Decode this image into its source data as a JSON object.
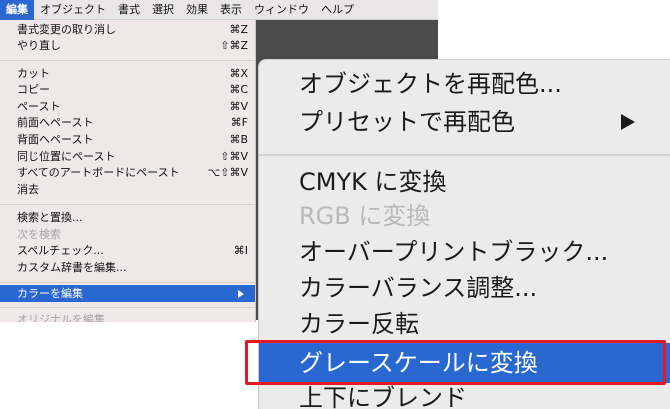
{
  "menubar": {
    "items": [
      "編集",
      "オブジェクト",
      "書式",
      "選択",
      "効果",
      "表示",
      "ウィンドウ",
      "ヘルプ"
    ],
    "active": "編集"
  },
  "edit_menu": {
    "items": [
      {
        "label": "書式変更の取り消し",
        "shortcut": "⌘Z"
      },
      {
        "label": "やり直し",
        "shortcut": "⇧⌘Z"
      },
      {
        "label": "カット",
        "shortcut": "⌘X"
      },
      {
        "label": "コピー",
        "shortcut": "⌘C"
      },
      {
        "label": "ペースト",
        "shortcut": "⌘V"
      },
      {
        "label": "前面へペースト",
        "shortcut": "⌘F"
      },
      {
        "label": "背面へペースト",
        "shortcut": "⌘B"
      },
      {
        "label": "同じ位置にペースト",
        "shortcut": "⇧⌘V"
      },
      {
        "label": "すべてのアートボードにペースト",
        "shortcut": "⌥⇧⌘V"
      },
      {
        "label": "消去",
        "shortcut": ""
      },
      {
        "label": "検索と置換...",
        "shortcut": ""
      },
      {
        "label": "次を検索",
        "shortcut": ""
      },
      {
        "label": "スペルチェック...",
        "shortcut": "⌘I"
      },
      {
        "label": "カスタム辞書を編集...",
        "shortcut": ""
      },
      {
        "label": "カラーを編集",
        "shortcut": ""
      },
      {
        "label": "オリジナルを編集",
        "shortcut": ""
      }
    ]
  },
  "color_submenu": {
    "items": [
      {
        "label": "オブジェクトを再配色..."
      },
      {
        "label": "プリセットで再配色"
      },
      {
        "label": "CMYK に変換"
      },
      {
        "label": "RGB に変換"
      },
      {
        "label": "オーバープリントブラック..."
      },
      {
        "label": "カラーバランス調整..."
      },
      {
        "label": "カラー反転"
      },
      {
        "label": "グレースケールに変換"
      },
      {
        "label": "上下にブレンド"
      }
    ]
  },
  "colors": {
    "selection": "#2a68d1",
    "highlight_box": "#e3191c",
    "menu_bg": "#f0e7e9",
    "submenu_bg": "#ecebeb"
  }
}
